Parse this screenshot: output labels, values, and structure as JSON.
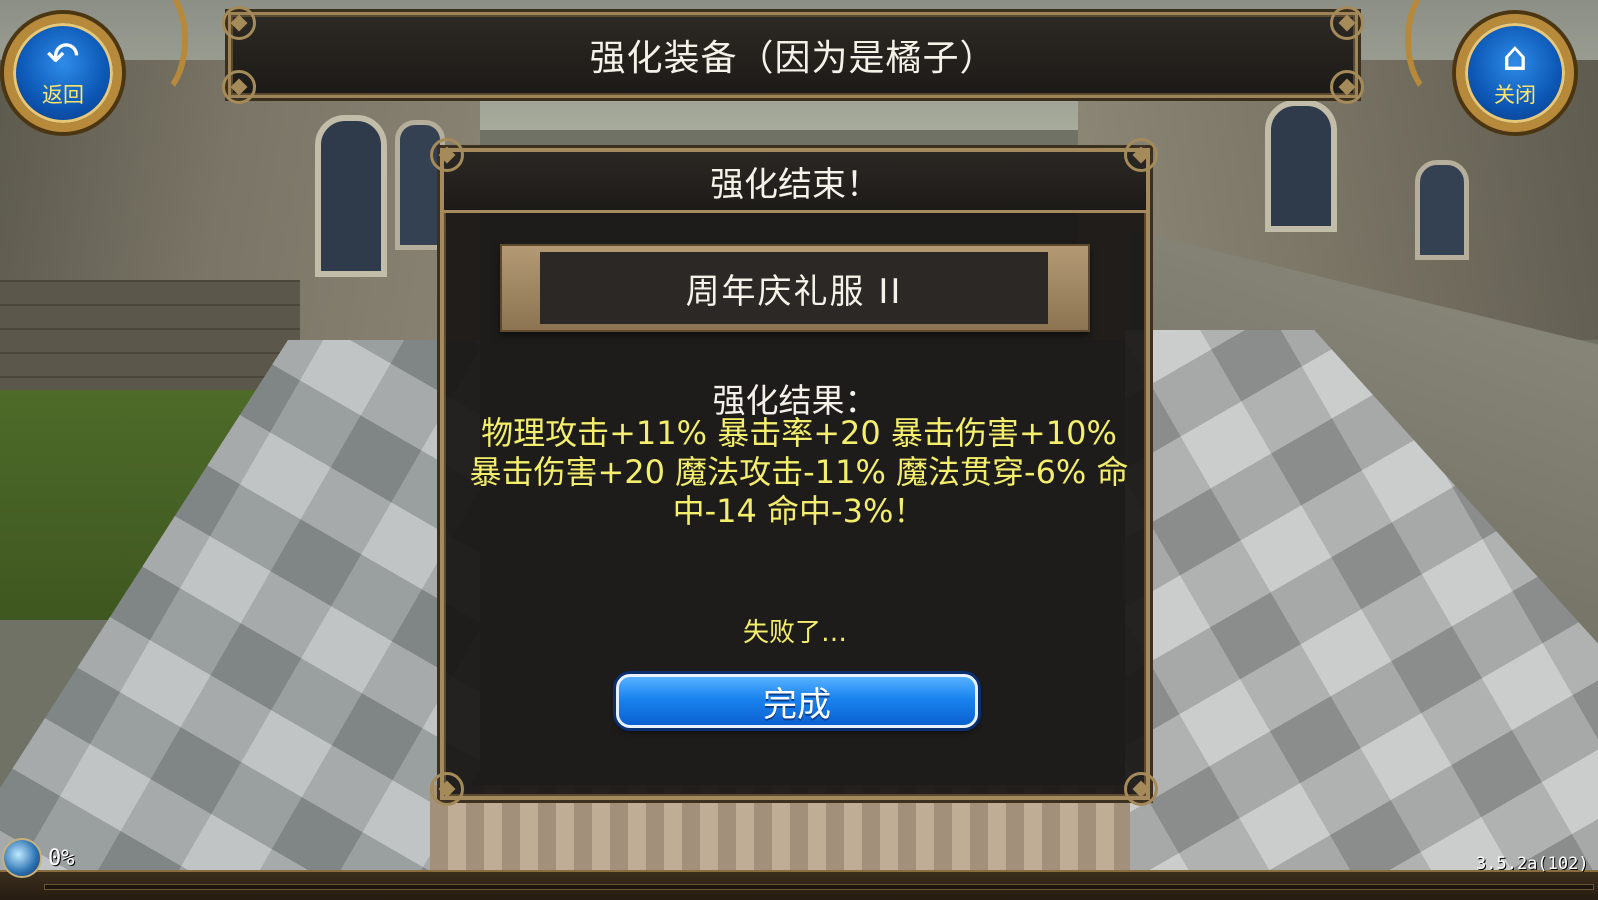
{
  "header": {
    "title": "强化装备（因为是橘子）",
    "back_button": {
      "icon": "return-arrow-icon",
      "label": "返回"
    },
    "close_button": {
      "icon": "home-icon",
      "label": "关闭"
    }
  },
  "dialog": {
    "title": "强化结束！",
    "item_name": "周年庆礼服 II",
    "result_label": "强化结果：",
    "result_text": "物理攻击+11% 暴击率+20 暴击伤害+10% 暴击伤害+20 魔法攻击-11% 魔法贯穿-6% 命中-14 命中-3%！",
    "status_text": "失败了…",
    "done_button": "完成"
  },
  "hud": {
    "exp_percent_text": "0%",
    "exp_fraction": 0.0,
    "version": "3.5.2a(102)"
  },
  "colors": {
    "accent_gold": "#a48a5d",
    "result_yellow": "#f3ee6c",
    "button_blue": "#1a84f0"
  }
}
